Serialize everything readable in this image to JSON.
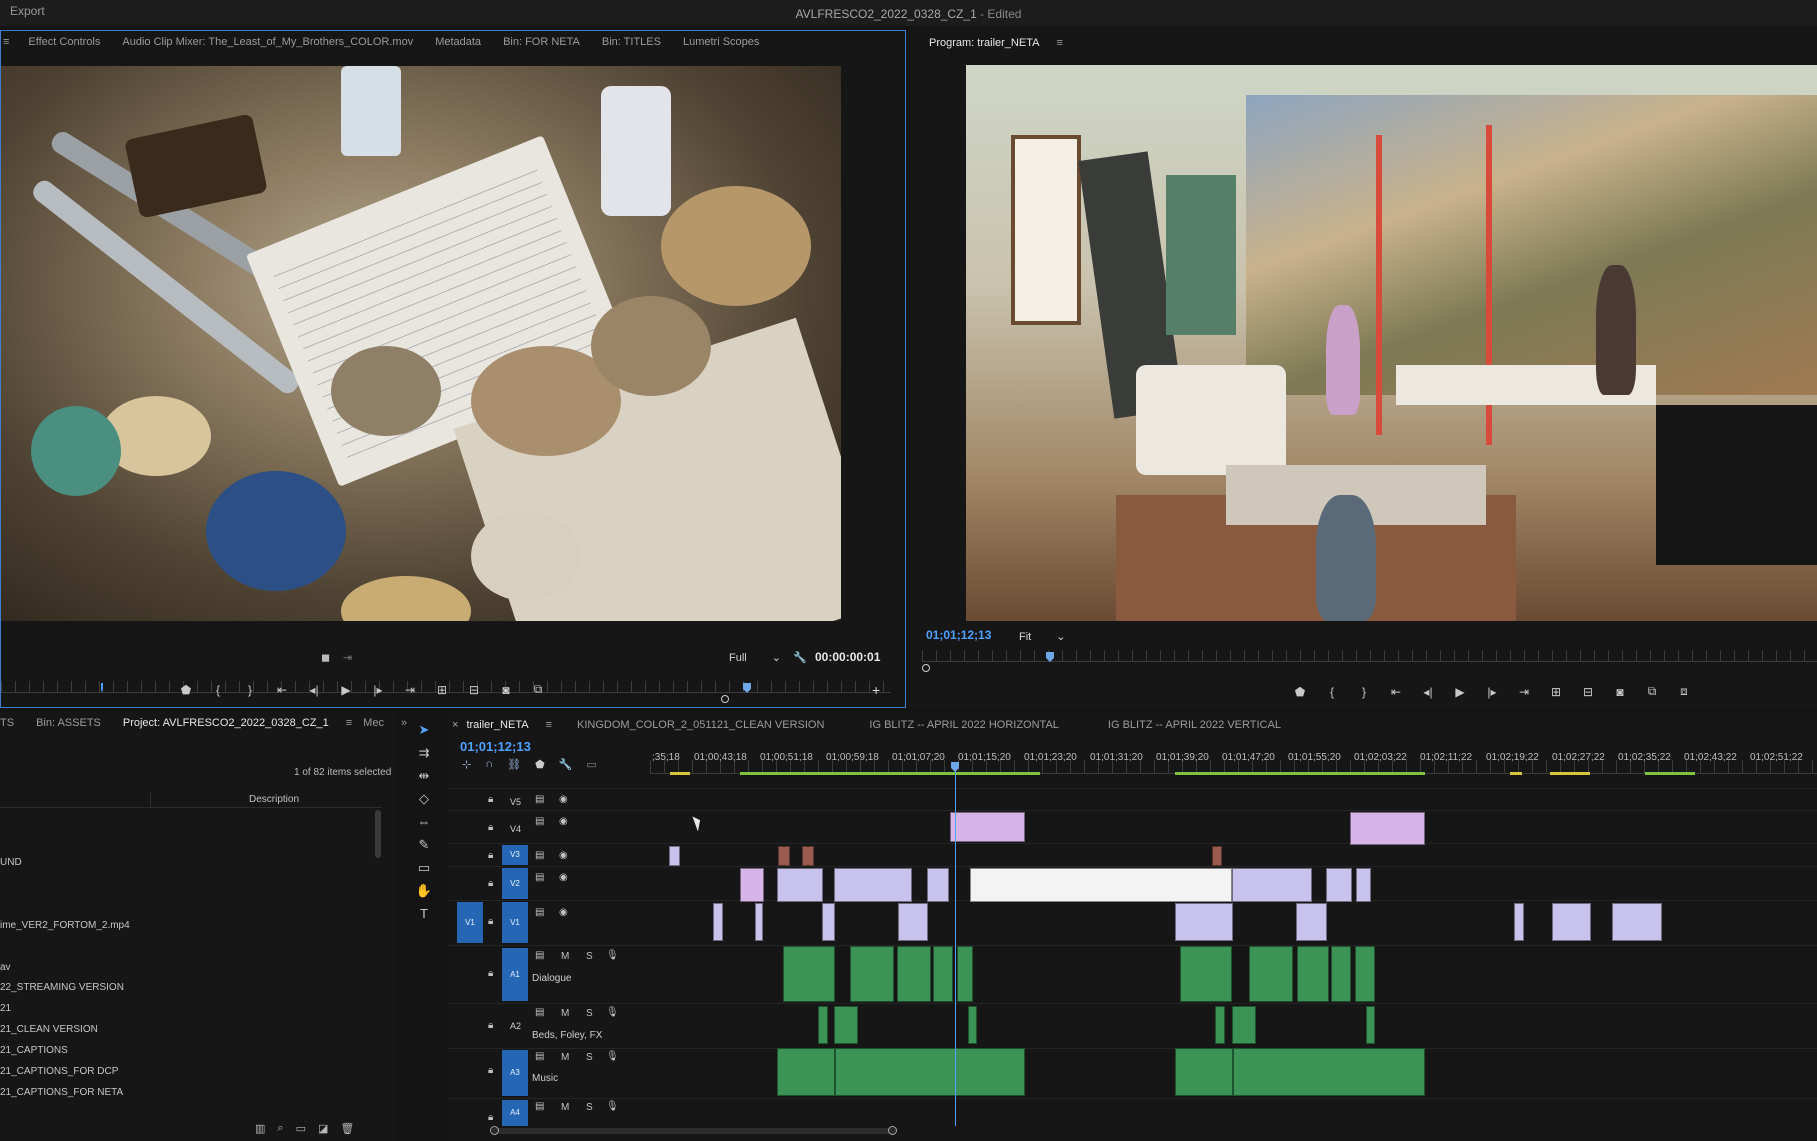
{
  "menubar": {
    "export_label": "Export",
    "title": "AVLFRESCO2_2022_0328_CZ_1",
    "title_suffix": " - Edited"
  },
  "source": {
    "tabs": [
      "Effect Controls",
      "Audio Clip Mixer: The_Least_of_My_Brothers_COLOR.mov",
      "Metadata",
      "Bin: FOR NETA",
      "Bin: TITLES",
      "Lumetri Scopes"
    ],
    "zoom": "Full",
    "timecode": "00:00:00:01"
  },
  "program": {
    "tab": "Program: trailer_NETA",
    "timecode": "01;01;12;13",
    "zoom": "Fit"
  },
  "project": {
    "tabs": [
      "TS",
      "Bin: ASSETS",
      "Project: AVLFRESCO2_2022_0328_CZ_1",
      "Mec"
    ],
    "items_selected": "1 of 82 items selected",
    "column_description": "Description",
    "rows": [
      "UND",
      "ime_VER2_FORTOM_2.mp4",
      "av",
      "22_STREAMING VERSION",
      "21",
      "21_CLEAN VERSION",
      "21_CAPTIONS",
      "21_CAPTIONS_FOR DCP",
      "21_CAPTIONS_FOR NETA"
    ]
  },
  "timeline": {
    "tabs": [
      "trailer_NETA",
      "KINGDOM_COLOR_2_051121_CLEAN VERSION",
      "IG BLITZ -- APRIL 2022 HORIZONTAL",
      "IG BLITZ -- APRIL 2022 VERTICAL"
    ],
    "timecode": "01;01;12;13",
    "ruler": [
      ";35;18",
      "01;00;43;18",
      "01;00;51;18",
      "01;00;59;18",
      "01;01;07;20",
      "01;01;15;20",
      "01;01;23;20",
      "01;01;31;20",
      "01;01;39;20",
      "01;01;47;20",
      "01;01;55;20",
      "01;02;03;22",
      "01;02;11;22",
      "01;02;19;22",
      "01;02;27;22",
      "01;02;35;22",
      "01;02;43;22",
      "01;02;51;22"
    ],
    "tracks": {
      "v5": "V5",
      "v4": "V4",
      "v3": "V3",
      "v2": "V2",
      "v1": "V1",
      "a1": "A1",
      "a1_name": "Dialogue",
      "a2": "A2",
      "a2_name": "Beds, Foley, FX",
      "a3": "A3",
      "a3_name": "Music",
      "a4": "A4",
      "src_v1": "V1"
    },
    "track_buttons": {
      "m": "M",
      "s": "S"
    }
  },
  "icons": {
    "accent": "#3c7fd0",
    "playhead": "#4ea1ff"
  }
}
